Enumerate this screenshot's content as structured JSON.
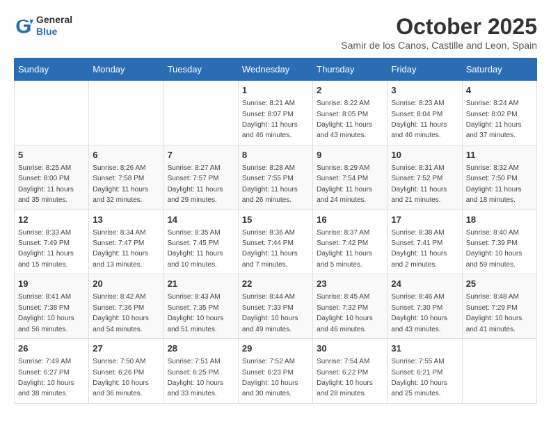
{
  "header": {
    "logo_line1": "General",
    "logo_line2": "Blue",
    "month_title": "October 2025",
    "subtitle": "Samir de los Canos, Castille and Leon, Spain"
  },
  "weekdays": [
    "Sunday",
    "Monday",
    "Tuesday",
    "Wednesday",
    "Thursday",
    "Friday",
    "Saturday"
  ],
  "weeks": [
    [
      {
        "day": "",
        "info": ""
      },
      {
        "day": "",
        "info": ""
      },
      {
        "day": "",
        "info": ""
      },
      {
        "day": "1",
        "info": "Sunrise: 8:21 AM\nSunset: 8:07 PM\nDaylight: 11 hours and 46 minutes."
      },
      {
        "day": "2",
        "info": "Sunrise: 8:22 AM\nSunset: 8:05 PM\nDaylight: 11 hours and 43 minutes."
      },
      {
        "day": "3",
        "info": "Sunrise: 8:23 AM\nSunset: 8:04 PM\nDaylight: 11 hours and 40 minutes."
      },
      {
        "day": "4",
        "info": "Sunrise: 8:24 AM\nSunset: 8:02 PM\nDaylight: 11 hours and 37 minutes."
      }
    ],
    [
      {
        "day": "5",
        "info": "Sunrise: 8:25 AM\nSunset: 8:00 PM\nDaylight: 11 hours and 35 minutes."
      },
      {
        "day": "6",
        "info": "Sunrise: 8:26 AM\nSunset: 7:58 PM\nDaylight: 11 hours and 32 minutes."
      },
      {
        "day": "7",
        "info": "Sunrise: 8:27 AM\nSunset: 7:57 PM\nDaylight: 11 hours and 29 minutes."
      },
      {
        "day": "8",
        "info": "Sunrise: 8:28 AM\nSunset: 7:55 PM\nDaylight: 11 hours and 26 minutes."
      },
      {
        "day": "9",
        "info": "Sunrise: 8:29 AM\nSunset: 7:54 PM\nDaylight: 11 hours and 24 minutes."
      },
      {
        "day": "10",
        "info": "Sunrise: 8:31 AM\nSunset: 7:52 PM\nDaylight: 11 hours and 21 minutes."
      },
      {
        "day": "11",
        "info": "Sunrise: 8:32 AM\nSunset: 7:50 PM\nDaylight: 11 hours and 18 minutes."
      }
    ],
    [
      {
        "day": "12",
        "info": "Sunrise: 8:33 AM\nSunset: 7:49 PM\nDaylight: 11 hours and 15 minutes."
      },
      {
        "day": "13",
        "info": "Sunrise: 8:34 AM\nSunset: 7:47 PM\nDaylight: 11 hours and 13 minutes."
      },
      {
        "day": "14",
        "info": "Sunrise: 8:35 AM\nSunset: 7:45 PM\nDaylight: 11 hours and 10 minutes."
      },
      {
        "day": "15",
        "info": "Sunrise: 8:36 AM\nSunset: 7:44 PM\nDaylight: 11 hours and 7 minutes."
      },
      {
        "day": "16",
        "info": "Sunrise: 8:37 AM\nSunset: 7:42 PM\nDaylight: 11 hours and 5 minutes."
      },
      {
        "day": "17",
        "info": "Sunrise: 8:38 AM\nSunset: 7:41 PM\nDaylight: 11 hours and 2 minutes."
      },
      {
        "day": "18",
        "info": "Sunrise: 8:40 AM\nSunset: 7:39 PM\nDaylight: 10 hours and 59 minutes."
      }
    ],
    [
      {
        "day": "19",
        "info": "Sunrise: 8:41 AM\nSunset: 7:38 PM\nDaylight: 10 hours and 56 minutes."
      },
      {
        "day": "20",
        "info": "Sunrise: 8:42 AM\nSunset: 7:36 PM\nDaylight: 10 hours and 54 minutes."
      },
      {
        "day": "21",
        "info": "Sunrise: 8:43 AM\nSunset: 7:35 PM\nDaylight: 10 hours and 51 minutes."
      },
      {
        "day": "22",
        "info": "Sunrise: 8:44 AM\nSunset: 7:33 PM\nDaylight: 10 hours and 49 minutes."
      },
      {
        "day": "23",
        "info": "Sunrise: 8:45 AM\nSunset: 7:32 PM\nDaylight: 10 hours and 46 minutes."
      },
      {
        "day": "24",
        "info": "Sunrise: 8:46 AM\nSunset: 7:30 PM\nDaylight: 10 hours and 43 minutes."
      },
      {
        "day": "25",
        "info": "Sunrise: 8:48 AM\nSunset: 7:29 PM\nDaylight: 10 hours and 41 minutes."
      }
    ],
    [
      {
        "day": "26",
        "info": "Sunrise: 7:49 AM\nSunset: 6:27 PM\nDaylight: 10 hours and 38 minutes."
      },
      {
        "day": "27",
        "info": "Sunrise: 7:50 AM\nSunset: 6:26 PM\nDaylight: 10 hours and 36 minutes."
      },
      {
        "day": "28",
        "info": "Sunrise: 7:51 AM\nSunset: 6:25 PM\nDaylight: 10 hours and 33 minutes."
      },
      {
        "day": "29",
        "info": "Sunrise: 7:52 AM\nSunset: 6:23 PM\nDaylight: 10 hours and 30 minutes."
      },
      {
        "day": "30",
        "info": "Sunrise: 7:54 AM\nSunset: 6:22 PM\nDaylight: 10 hours and 28 minutes."
      },
      {
        "day": "31",
        "info": "Sunrise: 7:55 AM\nSunset: 6:21 PM\nDaylight: 10 hours and 25 minutes."
      },
      {
        "day": "",
        "info": ""
      }
    ]
  ]
}
